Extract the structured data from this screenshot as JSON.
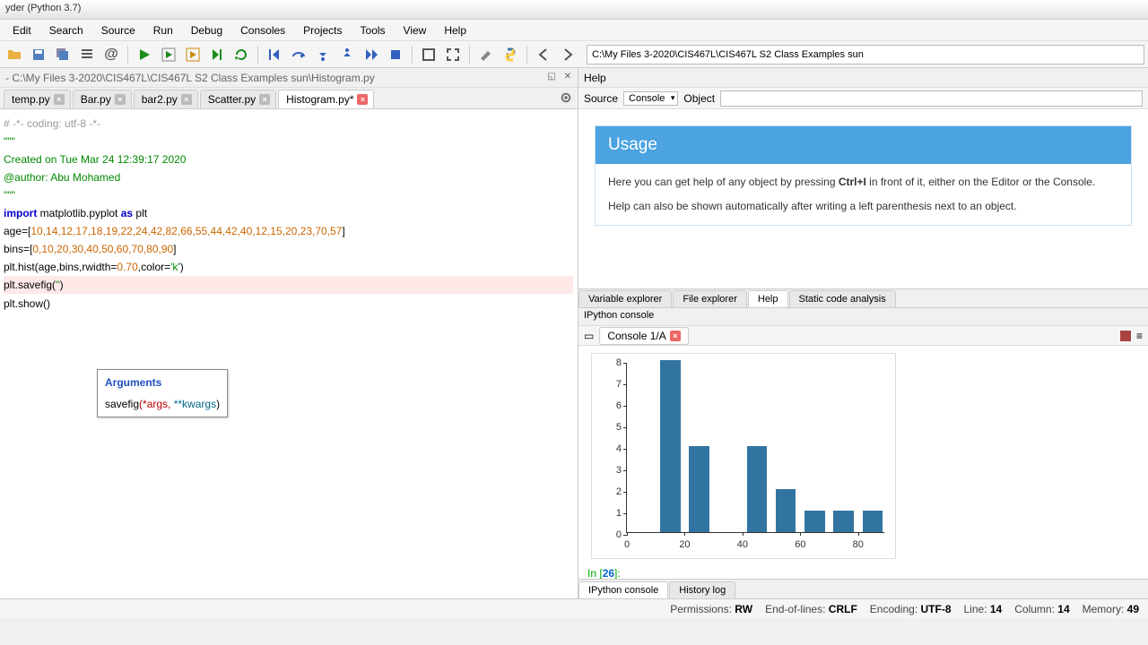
{
  "window": {
    "title": "yder (Python 3.7)"
  },
  "menu": [
    "Edit",
    "Search",
    "Source",
    "Run",
    "Debug",
    "Consoles",
    "Projects",
    "Tools",
    "View",
    "Help"
  ],
  "path_input": "C:\\My Files 3-2020\\CIS467L\\CIS467L S2 Class Examples sun",
  "breadcrumb": "- C:\\My Files 3-2020\\CIS467L\\CIS467L S2 Class Examples sun\\Histogram.py",
  "editor_tabs": [
    {
      "label": "temp.py",
      "modified": false,
      "active": false
    },
    {
      "label": "Bar.py",
      "modified": false,
      "active": false
    },
    {
      "label": "bar2.py",
      "modified": false,
      "active": false
    },
    {
      "label": "Scatter.py",
      "modified": false,
      "active": false
    },
    {
      "label": "Histogram.py*",
      "modified": true,
      "active": true
    }
  ],
  "code": {
    "l1": "# -*- coding: utf-8 -*-",
    "l2": "\"\"\"",
    "l3": "Created on Tue Mar 24 12:39:17 2020",
    "l4": "",
    "l5": "@author: Abu Mohamed",
    "l6": "\"\"\"",
    "l7": "",
    "l8_a": "import",
    "l8_b": " matplotlib.pyplot ",
    "l8_c": "as",
    "l8_d": " plt",
    "l9": "",
    "l10_a": "age=[",
    "l10_b": "10,14,12,17,18,19,22,24,42,82,66,55,44,42,40,12,15,20,23,70,57",
    "l10_c": "]",
    "l11_a": "bins=[",
    "l11_b": "0,10,20,30,40,50,60,70,80,90",
    "l11_c": "]",
    "l12": "",
    "l13_a": "plt.hist(age,bins,rwidth=",
    "l13_b": "0.70",
    "l13_c": ",color=",
    "l13_d": "'k'",
    "l13_e": ")",
    "l14_a": "plt.savefig(",
    "l14_b": "''",
    "l14_c": ")",
    "l15": "plt.show()"
  },
  "tooltip": {
    "title": "Arguments",
    "fn": "savefig",
    "sig_a": "(*args, ",
    "sig_b": "**kwargs",
    "sig_c": ")"
  },
  "help": {
    "pane_title": "Help",
    "source_label": "Source",
    "source_value": "Console",
    "object_label": "Object",
    "usage_title": "Usage",
    "usage_p1a": "Here you can get help of any object by pressing ",
    "usage_p1b": "Ctrl+I",
    "usage_p1c": " in front of it, either on the Editor or the Console.",
    "usage_p2": "Help can also be shown automatically after writing a left parenthesis next to an object."
  },
  "right_tabs": [
    "Variable explorer",
    "File explorer",
    "Help",
    "Static code analysis"
  ],
  "right_active": 2,
  "ipython": {
    "title": "IPython console",
    "tab": "Console 1/A",
    "prompt_in": "In [",
    "prompt_n": "26",
    "prompt_end": "]:"
  },
  "bottom_tabs": [
    "IPython console",
    "History log"
  ],
  "status": {
    "perm_l": "Permissions:",
    "perm_v": "RW",
    "eol_l": "End-of-lines:",
    "eol_v": "CRLF",
    "enc_l": "Encoding:",
    "enc_v": "UTF-8",
    "line_l": "Line:",
    "line_v": "14",
    "col_l": "Column:",
    "col_v": "14",
    "mem_l": "Memory:",
    "mem_v": "49"
  },
  "chart_data": {
    "type": "bar",
    "title": "",
    "xlabel": "",
    "ylabel": "",
    "bins": [
      0,
      10,
      20,
      30,
      40,
      50,
      60,
      70,
      80,
      90
    ],
    "values": [
      0,
      8,
      4,
      0,
      4,
      2,
      1,
      1,
      1
    ],
    "ylim": [
      0,
      8
    ],
    "yticks": [
      0,
      1,
      2,
      3,
      4,
      5,
      6,
      7,
      8
    ],
    "xticks": [
      0,
      20,
      40,
      60,
      80
    ]
  }
}
